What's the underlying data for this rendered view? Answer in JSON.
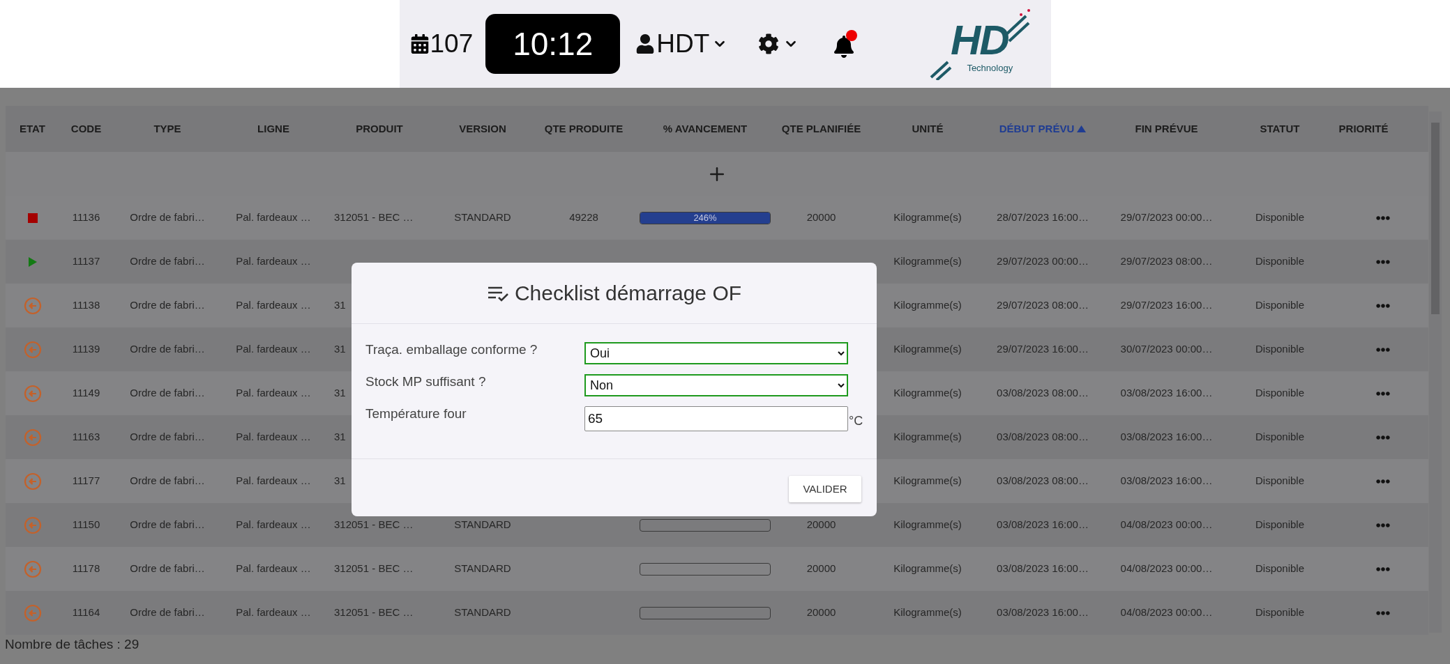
{
  "topbar": {
    "day_count": "107",
    "time": "10:12",
    "user": "HDT",
    "has_notification": true,
    "logo": {
      "mark": "HD",
      "name": "Technology"
    }
  },
  "table": {
    "columns": [
      {
        "label": "ETAT",
        "sorted": false
      },
      {
        "label": "CODE",
        "sorted": false
      },
      {
        "label": "TYPE",
        "sorted": false
      },
      {
        "label": "LIGNE",
        "sorted": false
      },
      {
        "label": "PRODUIT",
        "sorted": false
      },
      {
        "label": "VERSION",
        "sorted": false
      },
      {
        "label": "QTE PRODUITE",
        "sorted": false
      },
      {
        "label": "% AVANCEMENT",
        "sorted": false
      },
      {
        "label": "QTE PLANIFIÉE",
        "sorted": false
      },
      {
        "label": "UNITÉ",
        "sorted": false
      },
      {
        "label": "DÉBUT PRÉVU",
        "sorted": true
      },
      {
        "label": "FIN PRÉVUE",
        "sorted": false
      },
      {
        "label": "STATUT",
        "sorted": false
      },
      {
        "label": "PRIORITÉ",
        "sorted": false
      }
    ],
    "rows": [
      {
        "kind": "stopped",
        "code": "11136",
        "type": "Ordre de fabri…",
        "line": "Pal. fardeaux …",
        "product": "312051 - BEC …",
        "version": "STANDARD",
        "qty_produced": "49228",
        "progress": {
          "level": 1,
          "label": "246%"
        },
        "qty_planned": "20000",
        "unit": "Kilogramme(s)",
        "start": "28/07/2023 16:00…",
        "end": "29/07/2023 00:00…",
        "state": "Disponible"
      },
      {
        "kind": "running",
        "code": "11137",
        "type": "Ordre de fabri…",
        "line": "Pal. fardeaux …",
        "unit": "Kilogramme(s)",
        "start": "29/07/2023 00:00…",
        "end": "29/07/2023 08:00…",
        "state": "Disponible"
      },
      {
        "kind": "pending",
        "code": "11138",
        "type": "Ordre de fabri…",
        "line": "Pal. fardeaux …",
        "product": "31",
        "unit": "Kilogramme(s)",
        "start": "29/07/2023 08:00…",
        "end": "29/07/2023 16:00…",
        "state": "Disponible"
      },
      {
        "kind": "pending",
        "code": "11139",
        "type": "Ordre de fabri…",
        "line": "Pal. fardeaux …",
        "product": "31",
        "unit": "Kilogramme(s)",
        "start": "29/07/2023 16:00…",
        "end": "30/07/2023 00:00…",
        "state": "Disponible"
      },
      {
        "kind": "pending",
        "code": "11149",
        "type": "Ordre de fabri…",
        "line": "Pal. fardeaux …",
        "product": "31",
        "unit": "Kilogramme(s)",
        "start": "03/08/2023 08:00…",
        "end": "03/08/2023 16:00…",
        "state": "Disponible"
      },
      {
        "kind": "pending",
        "code": "11163",
        "type": "Ordre de fabri…",
        "line": "Pal. fardeaux …",
        "product": "31",
        "unit": "Kilogramme(s)",
        "start": "03/08/2023 08:00…",
        "end": "03/08/2023 16:00…",
        "state": "Disponible"
      },
      {
        "kind": "pending",
        "code": "11177",
        "type": "Ordre de fabri…",
        "line": "Pal. fardeaux …",
        "product": "31",
        "unit": "Kilogramme(s)",
        "start": "03/08/2023 08:00…",
        "end": "03/08/2023 16:00…",
        "state": "Disponible"
      },
      {
        "kind": "pending",
        "code": "11150",
        "type": "Ordre de fabri…",
        "line": "Pal. fardeaux …",
        "product": "312051 - BEC …",
        "version": "STANDARD",
        "progress": {
          "level": 0
        },
        "qty_planned": "20000",
        "unit": "Kilogramme(s)",
        "start": "03/08/2023 16:00…",
        "end": "04/08/2023 00:00…",
        "state": "Disponible"
      },
      {
        "kind": "pending",
        "code": "11178",
        "type": "Ordre de fabri…",
        "line": "Pal. fardeaux …",
        "product": "312051 - BEC …",
        "version": "STANDARD",
        "progress": {
          "level": 0
        },
        "qty_planned": "20000",
        "unit": "Kilogramme(s)",
        "start": "03/08/2023 16:00…",
        "end": "04/08/2023 00:00…",
        "state": "Disponible"
      },
      {
        "kind": "pending",
        "code": "11164",
        "type": "Ordre de fabri…",
        "line": "Pal. fardeaux …",
        "product": "312051 - BEC …",
        "version": "STANDARD",
        "progress": {
          "level": 0
        },
        "qty_planned": "20000",
        "unit": "Kilogramme(s)",
        "start": "03/08/2023 16:00…",
        "end": "04/08/2023 00:00…",
        "state": "Disponible"
      }
    ]
  },
  "footer": "Nombre de tâches : 29",
  "modal": {
    "title": "Checklist démarrage OF",
    "fields": [
      {
        "kind": "select",
        "label": "Traça. emballage conforme ?",
        "value": "Oui",
        "valid": true
      },
      {
        "kind": "select",
        "label": "Stock MP suffisant ?",
        "value": "Non",
        "valid": true
      },
      {
        "kind": "number",
        "label": "Température four",
        "value": "65",
        "unit": "°C"
      }
    ],
    "button": "VALIDER"
  }
}
